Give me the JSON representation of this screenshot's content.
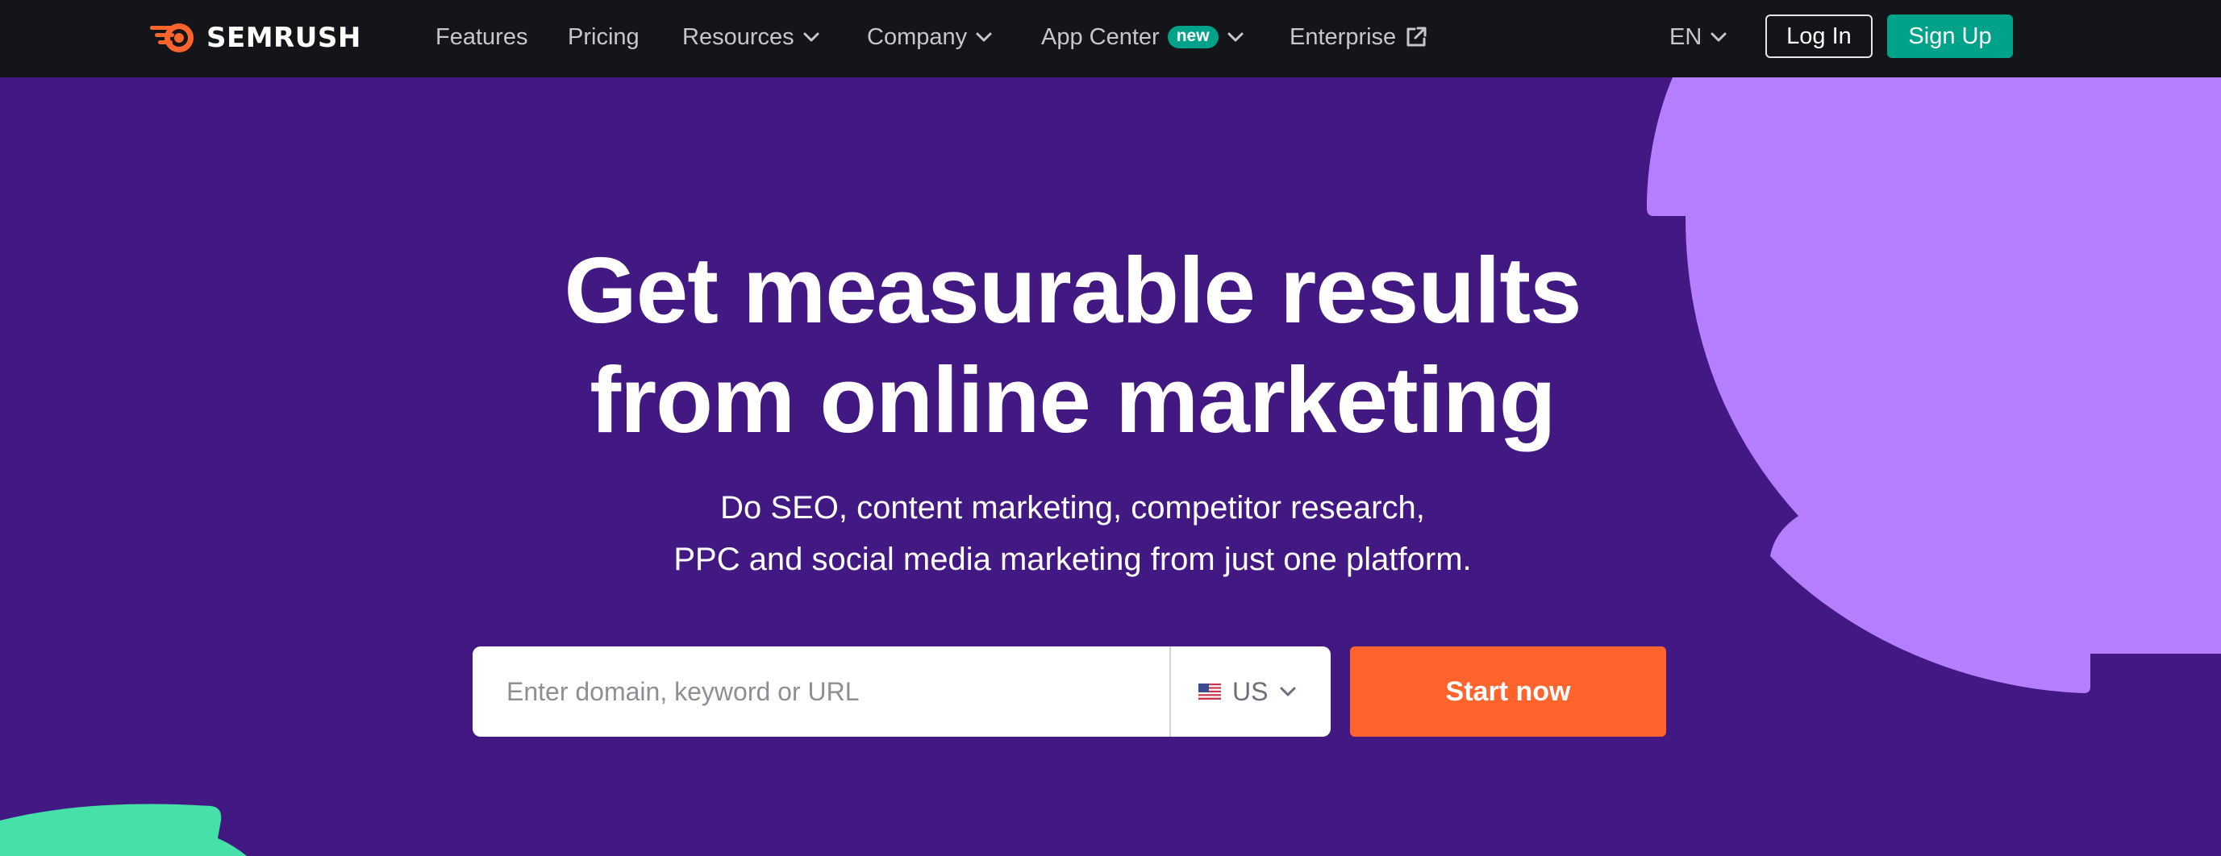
{
  "brand": {
    "name": "SEMRUSH",
    "logo_color": "#ff642d"
  },
  "nav": {
    "items": [
      {
        "label": "Features",
        "has_dropdown": false
      },
      {
        "label": "Pricing",
        "has_dropdown": false
      },
      {
        "label": "Resources",
        "has_dropdown": true
      },
      {
        "label": "Company",
        "has_dropdown": true
      },
      {
        "label": "App Center",
        "has_dropdown": true,
        "badge": "new"
      },
      {
        "label": "Enterprise",
        "has_dropdown": false,
        "icon": "external-link-icon"
      }
    ],
    "language": "EN",
    "login_label": "Log In",
    "signup_label": "Sign Up"
  },
  "hero": {
    "title_line1": "Get measurable results",
    "title_line2": "from online marketing",
    "subtitle_line1": "Do SEO, content marketing, competitor research,",
    "subtitle_line2": "PPC and social media marketing from just one platform.",
    "search_placeholder": "Enter domain, keyword or URL",
    "search_value": "",
    "database": {
      "flag_icon": "us-flag-icon",
      "selected": "US"
    },
    "cta_label": "Start now"
  },
  "colors": {
    "hero_bg": "#421983",
    "topbar_bg": "#141518",
    "accent_orange": "#ff642d",
    "accent_green": "#00a389",
    "deco_purple": "#b57eff",
    "deco_mint": "#45e1a9"
  }
}
